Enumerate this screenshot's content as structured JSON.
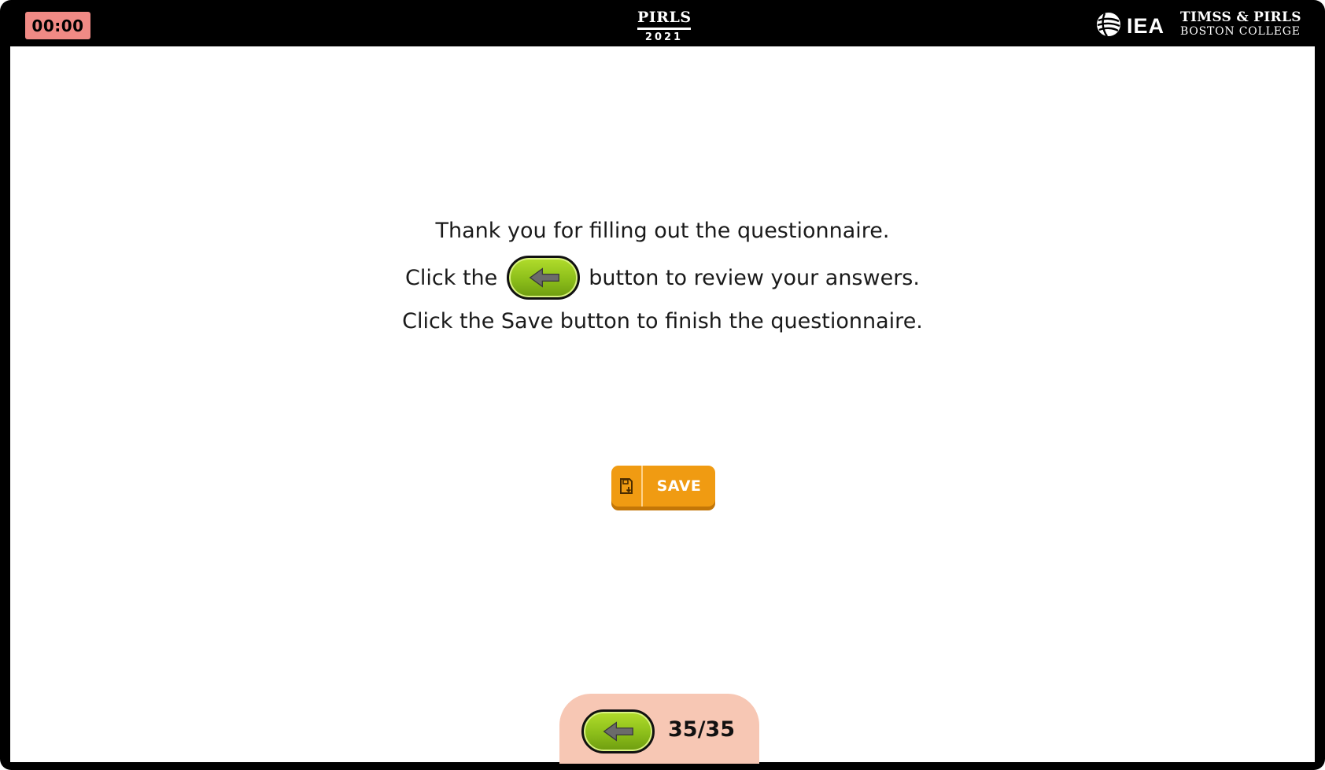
{
  "header": {
    "timer": "00:00",
    "pirls_name": "PIRLS",
    "pirls_year": "2021",
    "iea_text": "IEA",
    "center_line1": "TIMSS & PIRLS",
    "center_line2": "BOSTON COLLEGE"
  },
  "message": {
    "line1": "Thank you for filling out the questionnaire.",
    "line2_before": "Click the",
    "line2_after": "button to review your answers.",
    "line3": "Click the Save button to finish the questionnaire."
  },
  "save_button": {
    "label": "SAVE",
    "icon": "save-icon"
  },
  "navigation": {
    "back_icon": "arrow-left-icon",
    "page_count": "35/35"
  },
  "colors": {
    "timer_bg": "#f08a85",
    "save_bg": "#f09b12",
    "back_green": "#8cbe1a",
    "nav_tab_bg": "#f7c7b4"
  }
}
